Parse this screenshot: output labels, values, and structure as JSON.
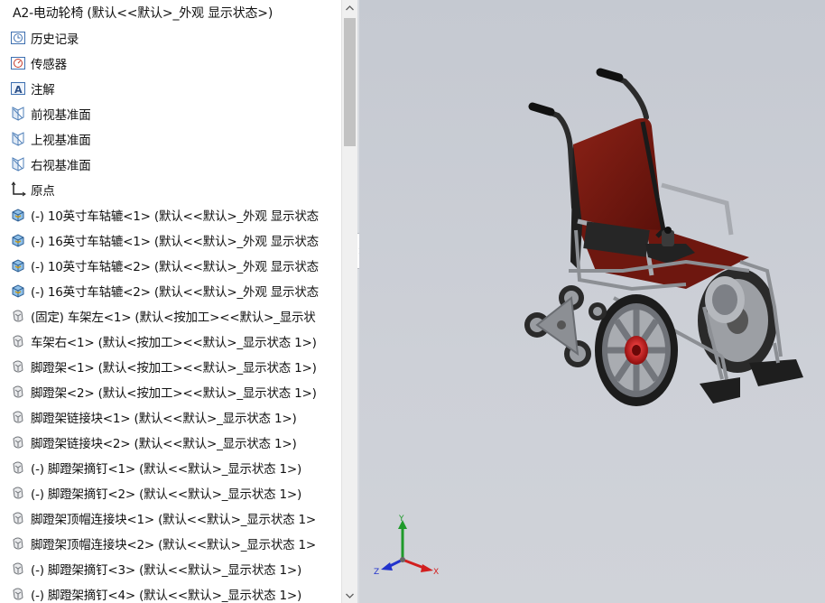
{
  "feature_tree": {
    "root": {
      "label": "A2-电动轮椅  (默认<<默认>_外观 显示状态>)",
      "icon": "assembly-icon"
    },
    "items": [
      {
        "label": "历史记录",
        "icon": "history-icon"
      },
      {
        "label": "传感器",
        "icon": "sensor-icon"
      },
      {
        "label": "注解",
        "icon": "annotation-icon"
      },
      {
        "label": "前视基准面",
        "icon": "plane-icon"
      },
      {
        "label": "上视基准面",
        "icon": "plane-icon"
      },
      {
        "label": "右视基准面",
        "icon": "plane-icon"
      },
      {
        "label": "原点",
        "icon": "origin-icon"
      },
      {
        "label": "(-) 10英寸车轱辘<1> (默认<<默认>_外观 显示状态",
        "icon": "subassembly-icon"
      },
      {
        "label": "(-) 16英寸车轱辘<1> (默认<<默认>_外观 显示状态",
        "icon": "subassembly-icon"
      },
      {
        "label": "(-) 10英寸车轱辘<2> (默认<<默认>_外观 显示状态",
        "icon": "subassembly-icon"
      },
      {
        "label": "(-) 16英寸车轱辘<2> (默认<<默认>_外观 显示状态",
        "icon": "subassembly-icon"
      },
      {
        "label": "(固定) 车架左<1> (默认<按加工><<默认>_显示状",
        "icon": "part-icon"
      },
      {
        "label": "车架右<1> (默认<按加工><<默认>_显示状态 1>)",
        "icon": "part-icon"
      },
      {
        "label": "脚蹬架<1> (默认<按加工><<默认>_显示状态 1>)",
        "icon": "part-icon"
      },
      {
        "label": "脚蹬架<2> (默认<按加工><<默认>_显示状态 1>)",
        "icon": "part-icon"
      },
      {
        "label": "脚蹬架链接块<1> (默认<<默认>_显示状态 1>)",
        "icon": "part-icon"
      },
      {
        "label": "脚蹬架链接块<2> (默认<<默认>_显示状态 1>)",
        "icon": "part-icon"
      },
      {
        "label": "(-) 脚蹬架摘钉<1> (默认<<默认>_显示状态 1>)",
        "icon": "part-icon"
      },
      {
        "label": "(-) 脚蹬架摘钉<2> (默认<<默认>_显示状态 1>)",
        "icon": "part-icon"
      },
      {
        "label": "脚蹬架顶帽连接块<1> (默认<<默认>_显示状态 1>",
        "icon": "part-icon"
      },
      {
        "label": "脚蹬架顶帽连接块<2> (默认<<默认>_显示状态 1>",
        "icon": "part-icon"
      },
      {
        "label": "(-) 脚蹬架摘钉<3> (默认<<默认>_显示状态 1>)",
        "icon": "part-icon"
      },
      {
        "label": "(-) 脚蹬架摘钉<4> (默认<<默认>_显示状态 1>)",
        "icon": "part-icon"
      }
    ]
  },
  "viewport": {
    "model": "wheelchair-3d-model",
    "triad": {
      "x_label": "X",
      "y_label": "Y",
      "z_label": "Z"
    }
  },
  "colors": {
    "seat": "#7a1a12",
    "frame": "#8c8f94",
    "tire": "#1c1c1c",
    "hub": "#c01818",
    "viewport_bg": "#cacdd4",
    "axis_x": "#d21f1f",
    "axis_y": "#1f9a2a",
    "axis_z": "#2233cc"
  }
}
